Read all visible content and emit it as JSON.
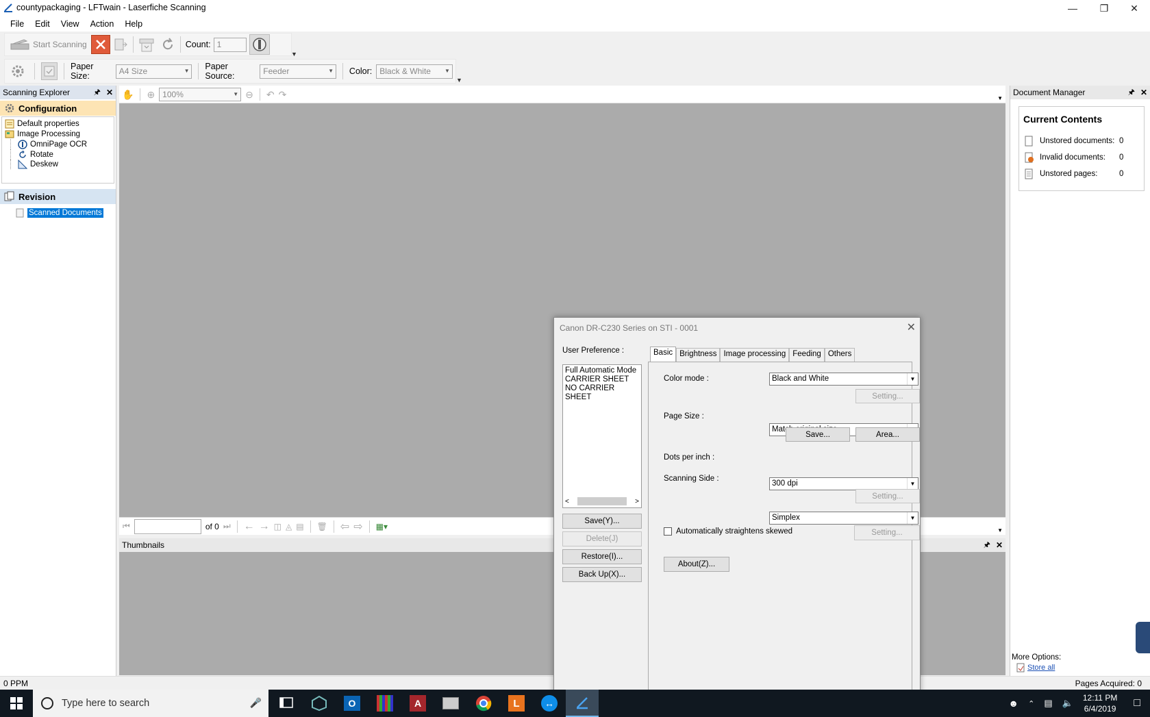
{
  "window": {
    "title": "countypackaging - LFTwain - Laserfiche Scanning"
  },
  "menu": [
    "File",
    "Edit",
    "View",
    "Action",
    "Help"
  ],
  "toolbar1": {
    "start_scanning": "Start Scanning",
    "count_label": "Count:",
    "count_value": "1"
  },
  "toolbar2": {
    "paper_size_label": "Paper Size:",
    "paper_size_value": "A4 Size",
    "paper_source_label": "Paper Source:",
    "paper_source_value": "Feeder",
    "color_label": "Color:",
    "color_value": "Black & White"
  },
  "viewer": {
    "zoom": "100%",
    "page_of": "of 0"
  },
  "scanning_explorer": {
    "title": "Scanning Explorer",
    "configuration": "Configuration",
    "items": [
      "Default properties",
      "Image Processing",
      "OmniPage OCR",
      "Rotate",
      "Deskew"
    ],
    "revision": "Revision",
    "scanned_documents": "Scanned Documents"
  },
  "thumbnails": {
    "title": "Thumbnails"
  },
  "document_manager": {
    "title": "Document Manager",
    "current_contents": "Current Contents",
    "rows": [
      {
        "label": "Unstored documents:",
        "value": "0"
      },
      {
        "label": "Invalid documents:",
        "value": "0"
      },
      {
        "label": "Unstored pages:",
        "value": "0"
      }
    ],
    "more_options": "More Options:",
    "store_all": "Store all"
  },
  "status": {
    "ppm": "0 PPM",
    "pages_acquired": "Pages Acquired: 0"
  },
  "dialog": {
    "title": "Canon DR-C230 Series on STI - 0001",
    "user_pref_label": "User Preference :",
    "prefs": [
      "Full Automatic Mode",
      "CARRIER SHEET",
      "NO CARRIER SHEET"
    ],
    "buttons_left": [
      "Save(Y)...",
      "Delete(J)",
      "Restore(I)...",
      "Back Up(X)..."
    ],
    "tabs": [
      "Basic",
      "Brightness",
      "Image processing",
      "Feeding",
      "Others"
    ],
    "color_mode_label": "Color mode :",
    "color_mode_value": "Black and White",
    "page_size_label": "Page Size :",
    "page_size_value": "Match original size",
    "dpi_label": "Dots per inch :",
    "dpi_value": "300 dpi",
    "side_label": "Scanning Side :",
    "side_value": "Simplex",
    "setting": "Setting...",
    "save": "Save...",
    "area": "Area...",
    "auto_straighten": "Automatically straightens skewed",
    "about": "About(Z)..."
  },
  "taskbar": {
    "search_placeholder": "Type here to search",
    "time": "12:11 PM",
    "date": "6/4/2019"
  }
}
